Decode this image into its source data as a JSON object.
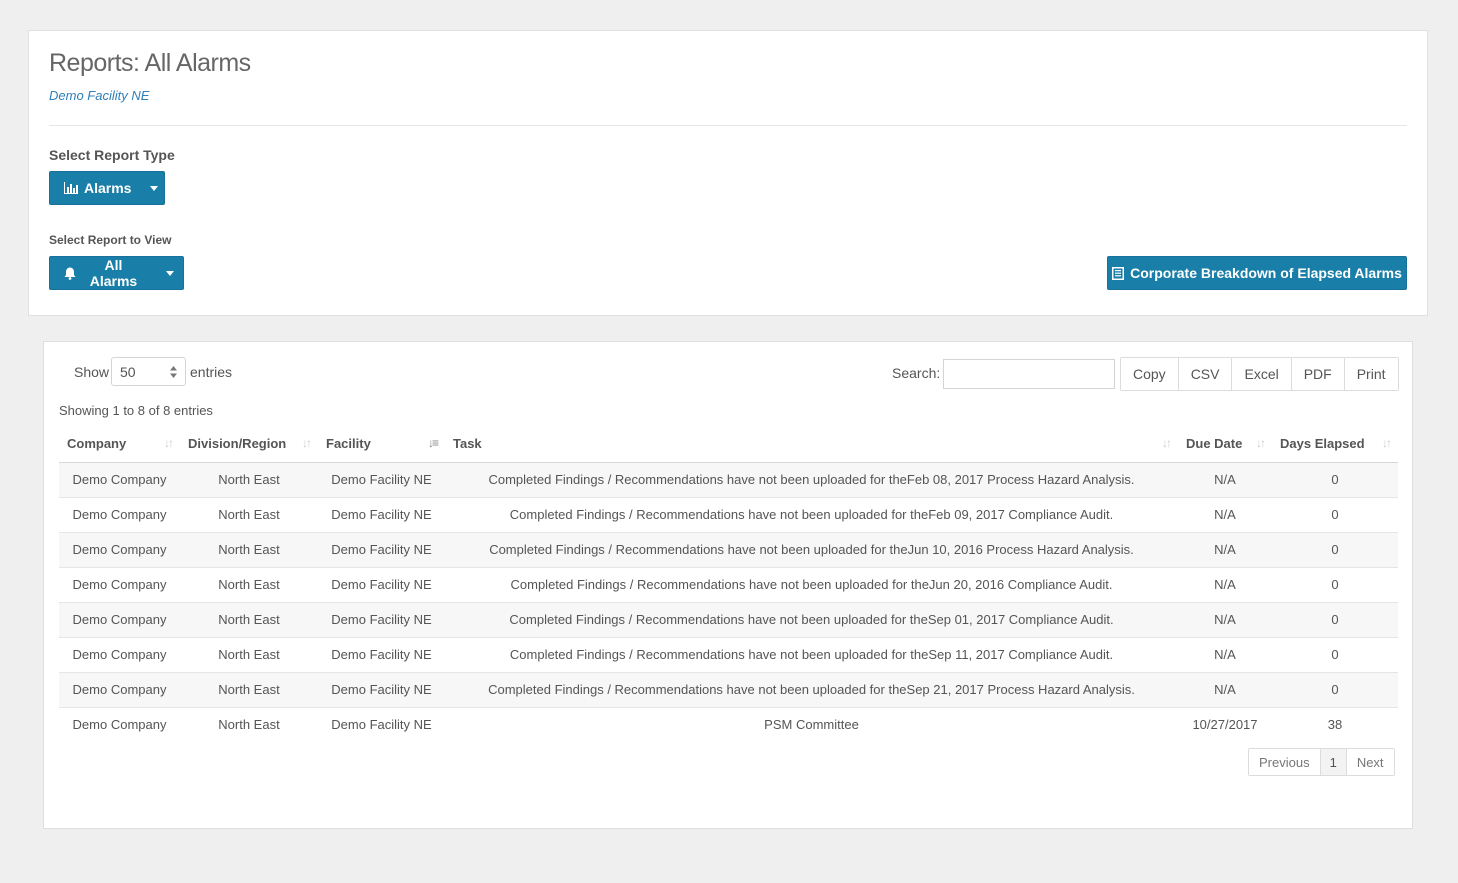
{
  "header": {
    "title": "Reports: All Alarms",
    "facility": "Demo Facility NE"
  },
  "report_type": {
    "label": "Select Report Type",
    "button_label": "Alarms",
    "icon": "bar-chart-icon"
  },
  "report_view": {
    "label": "Select Report to View",
    "button_label": "All Alarms",
    "icon": "bell-icon"
  },
  "corporate_button": {
    "label": "Corporate Breakdown of Elapsed Alarms",
    "icon": "document-icon"
  },
  "table_controls": {
    "show_label": "Show",
    "entries_value": "50",
    "entries_label": "entries",
    "search_label": "Search:",
    "search_value": "",
    "export_buttons": [
      "Copy",
      "CSV",
      "Excel",
      "PDF",
      "Print"
    ],
    "info": "Showing 1 to 8 of 8 entries"
  },
  "table": {
    "columns": [
      "Company",
      "Division/Region",
      "Facility",
      "Task",
      "Due Date",
      "Days Elapsed"
    ],
    "rows": [
      [
        "Demo Company",
        "North East",
        "Demo Facility NE",
        "Completed Findings / Recommendations have not been uploaded for theFeb 08, 2017 Process Hazard Analysis.",
        "N/A",
        "0"
      ],
      [
        "Demo Company",
        "North East",
        "Demo Facility NE",
        "Completed Findings / Recommendations have not been uploaded for theFeb 09, 2017 Compliance Audit.",
        "N/A",
        "0"
      ],
      [
        "Demo Company",
        "North East",
        "Demo Facility NE",
        "Completed Findings / Recommendations have not been uploaded for theJun 10, 2016 Process Hazard Analysis.",
        "N/A",
        "0"
      ],
      [
        "Demo Company",
        "North East",
        "Demo Facility NE",
        "Completed Findings / Recommendations have not been uploaded for theJun 20, 2016 Compliance Audit.",
        "N/A",
        "0"
      ],
      [
        "Demo Company",
        "North East",
        "Demo Facility NE",
        "Completed Findings / Recommendations have not been uploaded for theSep 01, 2017 Compliance Audit.",
        "N/A",
        "0"
      ],
      [
        "Demo Company",
        "North East",
        "Demo Facility NE",
        "Completed Findings / Recommendations have not been uploaded for theSep 11, 2017 Compliance Audit.",
        "N/A",
        "0"
      ],
      [
        "Demo Company",
        "North East",
        "Demo Facility NE",
        "Completed Findings / Recommendations have not been uploaded for theSep 21, 2017 Process Hazard Analysis.",
        "N/A",
        "0"
      ],
      [
        "Demo Company",
        "North East",
        "Demo Facility NE",
        "PSM Committee",
        "10/27/2017",
        "38"
      ]
    ]
  },
  "pagination": {
    "previous": "Previous",
    "current": "1",
    "next": "Next"
  },
  "colors": {
    "primary": "#1a7fa8",
    "link": "#2e7fb8",
    "background": "#efefef"
  }
}
